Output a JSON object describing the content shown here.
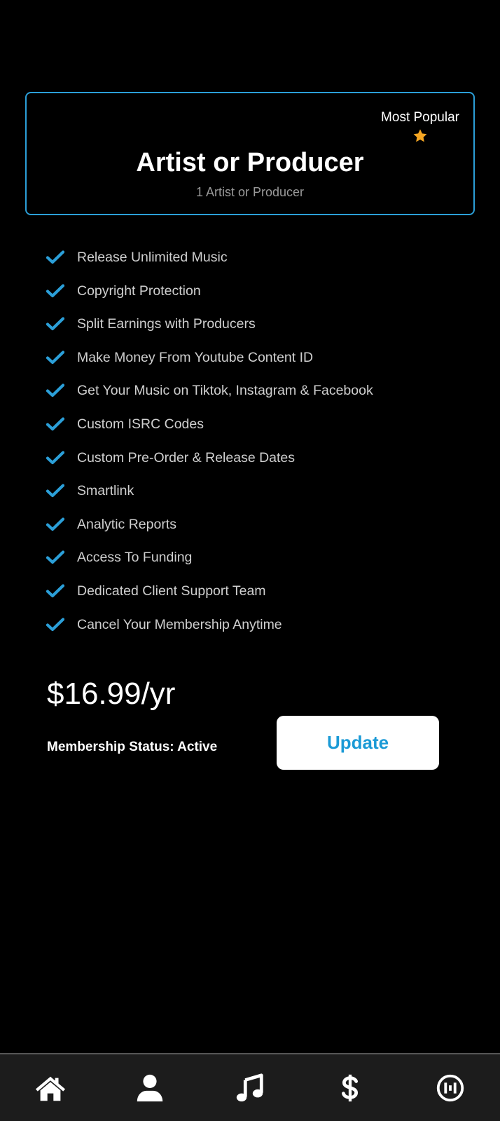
{
  "plan": {
    "badge": "Most Popular",
    "title": "Artist or Producer",
    "subtitle": "1 Artist or Producer"
  },
  "features": [
    "Release Unlimited Music",
    "Copyright Protection",
    "Split Earnings with Producers",
    "Make Money From Youtube Content ID",
    "Get Your Music on Tiktok, Instagram & Facebook",
    "Custom ISRC Codes",
    "Custom Pre-Order & Release Dates",
    "Smartlink",
    "Analytic Reports",
    "Access To Funding",
    "Dedicated Client Support Team",
    "Cancel Your Membership Anytime"
  ],
  "pricing": {
    "price": "$16.99/yr",
    "status": "Membership Status: Active",
    "update_label": "Update"
  },
  "nav": {
    "items": [
      {
        "icon": "home-icon"
      },
      {
        "icon": "profile-icon"
      },
      {
        "icon": "music-note-icon"
      },
      {
        "icon": "dollar-icon"
      },
      {
        "icon": "brand-logo-icon"
      }
    ]
  },
  "colors": {
    "accent": "#2b9fd8",
    "star": "#f5a623",
    "background": "#000000",
    "nav_background": "#1c1c1c"
  }
}
